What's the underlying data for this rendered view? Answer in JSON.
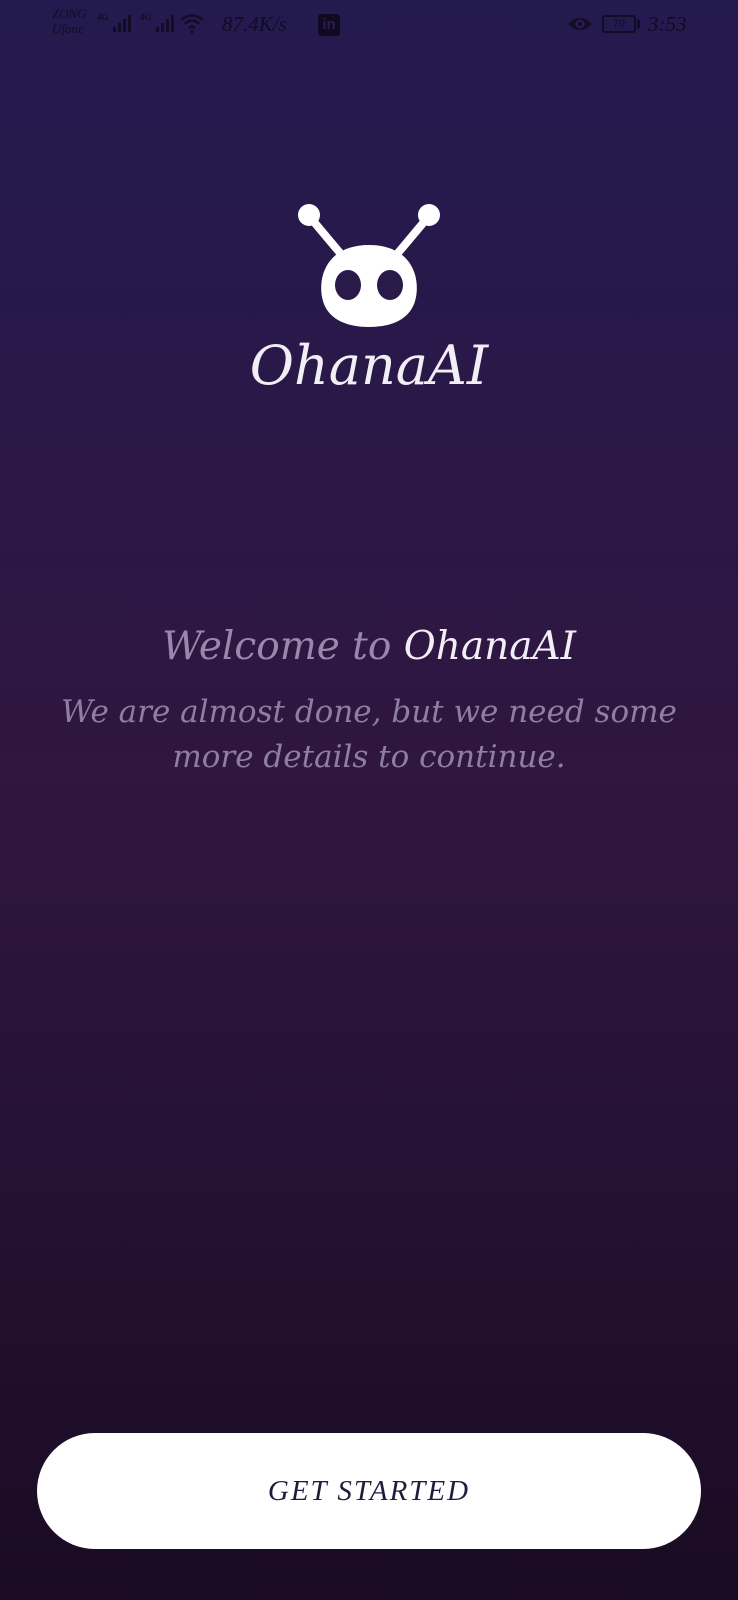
{
  "status_bar": {
    "carrier_top": "ZONG",
    "carrier_bottom": "Ufone",
    "network_1": "4G",
    "network_2": "4G",
    "net_speed": "87.4K/s",
    "linkedin_label": "in",
    "battery_level": "79",
    "time": "3:53",
    "icons": [
      "signal-icon",
      "signal-icon",
      "wifi-icon",
      "linkedin-icon",
      "eye-icon",
      "battery-icon"
    ]
  },
  "app": {
    "title": "OhanaAI"
  },
  "welcome": {
    "prefix": "Welcome to",
    "brand": "OhanaAI",
    "subtitle": "We are almost done, but we need some more details to continue."
  },
  "actions": {
    "get_started_label": "GET STARTED"
  },
  "colors": {
    "background_top": "#231a4f",
    "background_bottom": "#1a0b23",
    "text_primary": "#f2eef6",
    "text_muted": "#9a88ac",
    "button_bg": "#ffffff",
    "button_text": "#261a3c"
  }
}
